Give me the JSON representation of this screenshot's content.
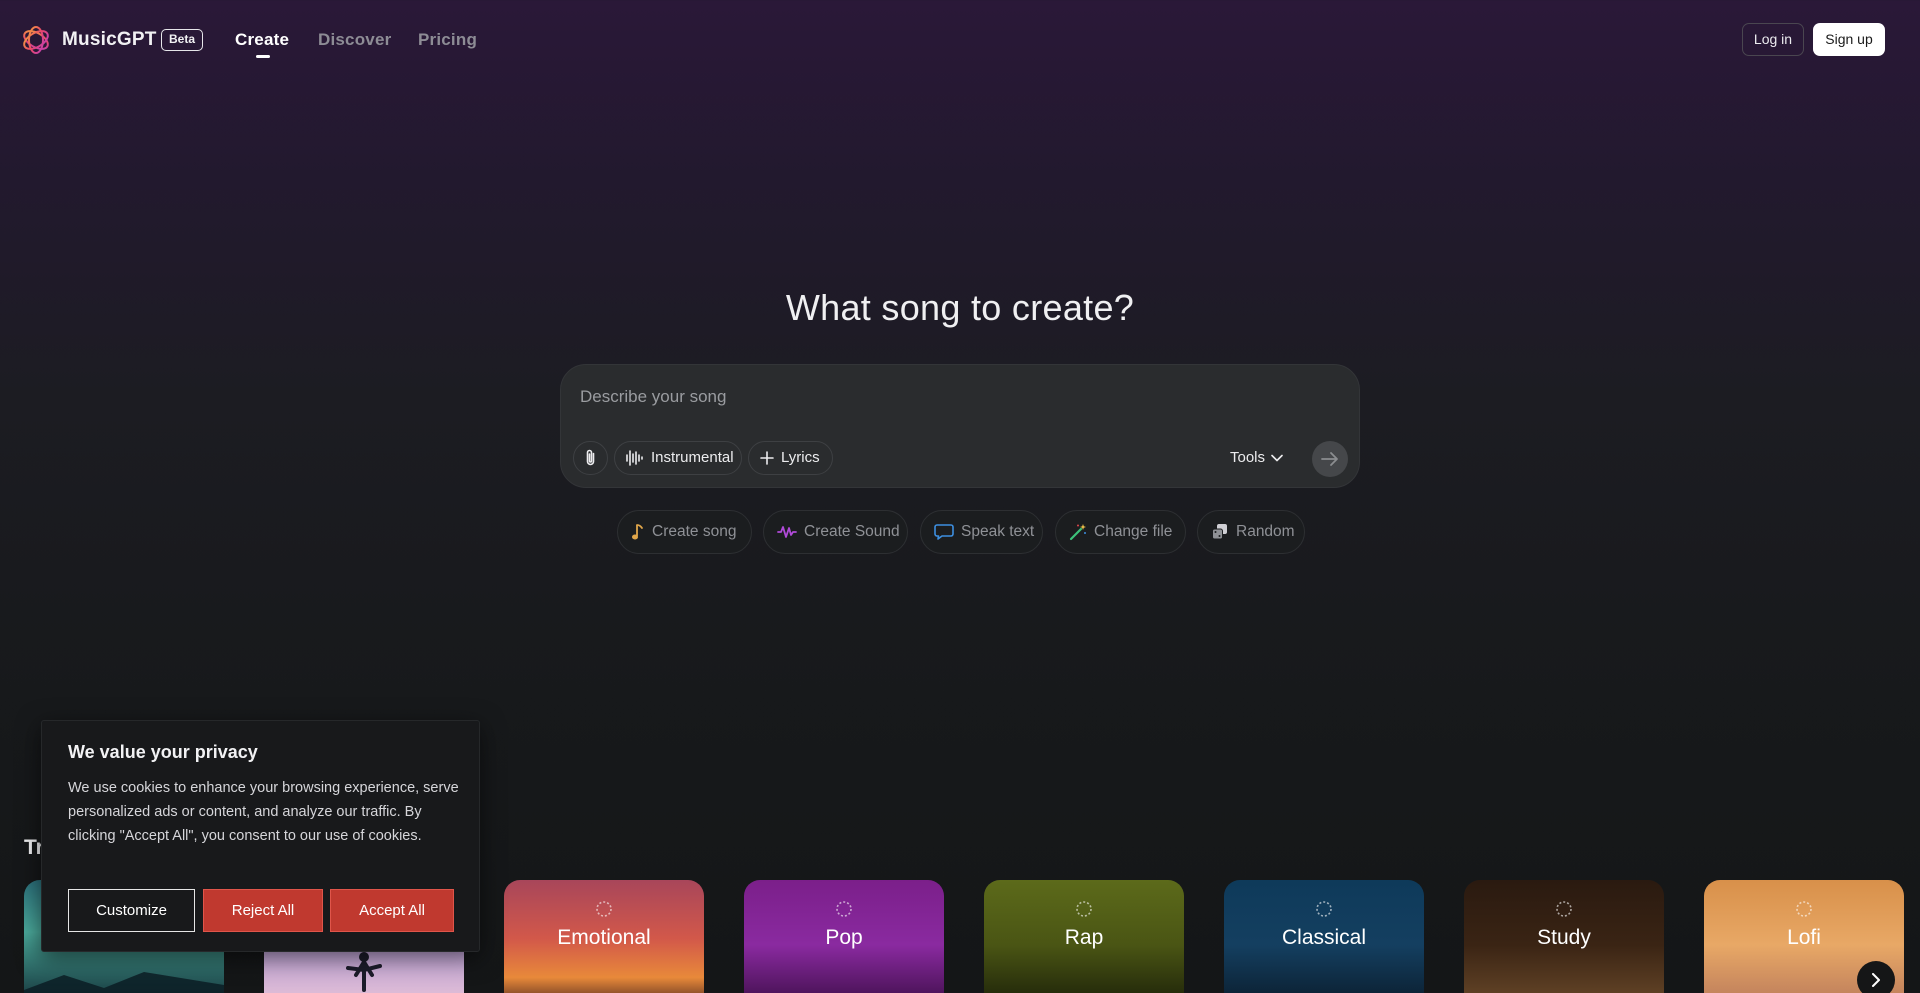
{
  "header": {
    "brand": "MusicGPT",
    "badge": "Beta",
    "nav": [
      {
        "label": "Create"
      },
      {
        "label": "Discover"
      },
      {
        "label": "Pricing"
      }
    ],
    "login_label": "Log in",
    "signup_label": "Sign up"
  },
  "hero": {
    "title": "What song to create?",
    "prompt_placeholder": "Describe your song",
    "chips": {
      "attach_icon": "paperclip-icon",
      "instrumental": "Instrumental",
      "lyrics": "Lyrics"
    },
    "tools_label": "Tools",
    "send_icon": "arrow-right-icon"
  },
  "quick_actions": [
    {
      "label": "Create song",
      "icon": "music-note-icon",
      "color": "#e0a64a"
    },
    {
      "label": "Create Sound",
      "icon": "waveform-icon",
      "color": "#b04ad8"
    },
    {
      "label": "Speak text",
      "icon": "speech-bubble-icon",
      "color": "#3d8fe0"
    },
    {
      "label": "Change file",
      "icon": "magic-wand-icon",
      "color": "#3cc27a"
    },
    {
      "label": "Random",
      "icon": "dice-icon",
      "color": "#cfcfd4"
    }
  ],
  "section": {
    "title_peek": "Tr"
  },
  "genres": [
    {
      "label": "",
      "name": "genre-card-1"
    },
    {
      "label": "",
      "name": "genre-card-2"
    },
    {
      "label": "Emotional"
    },
    {
      "label": "Pop"
    },
    {
      "label": "Rap"
    },
    {
      "label": "Classical"
    },
    {
      "label": "Study"
    },
    {
      "label": "Lofi"
    }
  ],
  "cookie": {
    "title": "We value your privacy",
    "text": "We use cookies to enhance your browsing experience, serve personalized ads or content, and analyze our traffic. By clicking \"Accept All\", you consent to our use of cookies.",
    "customize": "Customize",
    "reject": "Reject All",
    "accept": "Accept All"
  },
  "colors": {
    "accent_red": "#c0392f",
    "surface": "#2a2c2e"
  }
}
